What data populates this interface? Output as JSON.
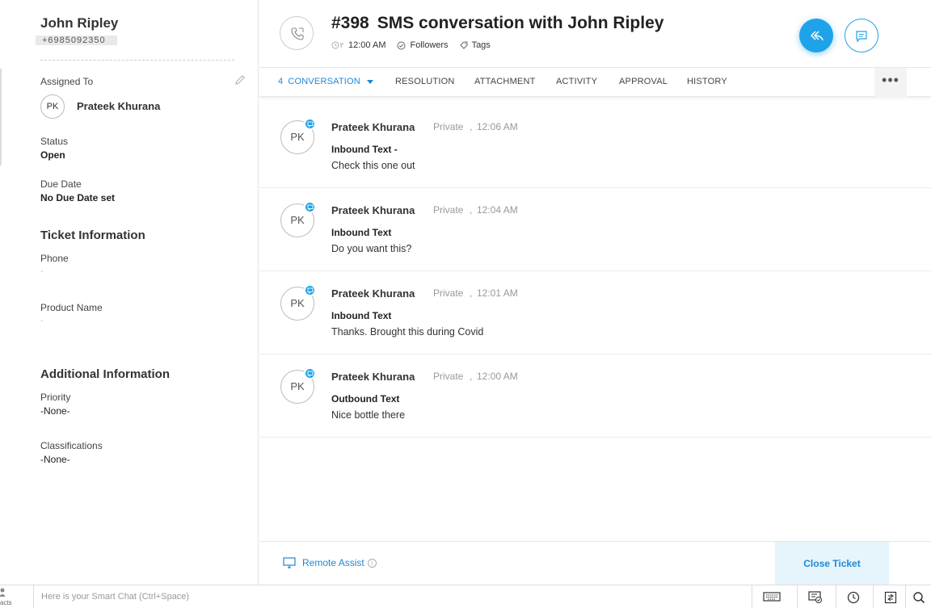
{
  "contact": {
    "name": "John Ripley",
    "phone": "+6985092350"
  },
  "left_panel": {
    "assigned_to_label": "Assigned To",
    "assignee_initials": "PK",
    "assignee_name": "Prateek Khurana",
    "status_label": "Status",
    "status_value": "Open",
    "due_date_label": "Due Date",
    "due_date_value": "No Due Date set",
    "ticket_info_title": "Ticket Information",
    "phone_label": "Phone",
    "phone_value": "-",
    "product_label": "Product Name",
    "product_value": "-",
    "additional_title": "Additional Information",
    "priority_label": "Priority",
    "priority_value": "-None-",
    "classifications_label": "Classifications",
    "classifications_value": "-None-"
  },
  "header": {
    "ticket_number": "#398",
    "title": "SMS conversation with John Ripley",
    "time": "12:00 AM",
    "followers_label": "Followers",
    "tags_label": "Tags"
  },
  "tabs": {
    "conversation_count": "4",
    "conversation": "CONVERSATION",
    "resolution": "RESOLUTION",
    "attachment": "ATTACHMENT",
    "activity": "ACTIVITY",
    "approval": "APPROVAL",
    "history": "HISTORY",
    "more": "•••"
  },
  "messages": [
    {
      "initials": "PK",
      "author": "Prateek Khurana",
      "visibility": "Private",
      "sep": ",",
      "time": "12:06 AM",
      "type": "Inbound Text -",
      "body": "Check this one out"
    },
    {
      "initials": "PK",
      "author": "Prateek Khurana",
      "visibility": "Private",
      "sep": ",",
      "time": "12:04 AM",
      "type": "Inbound Text",
      "body": "Do you want this?"
    },
    {
      "initials": "PK",
      "author": "Prateek Khurana",
      "visibility": "Private",
      "sep": ",",
      "time": "12:01 AM",
      "type": "Inbound Text",
      "body": "Thanks. Brought this during Covid"
    },
    {
      "initials": "PK",
      "author": "Prateek Khurana",
      "visibility": "Private",
      "sep": ",",
      "time": "12:00 AM",
      "type": "Outbound Text",
      "body": "Nice bottle there"
    }
  ],
  "footer": {
    "remote_assist": "Remote Assist",
    "info": "i",
    "close_ticket": "Close Ticket"
  },
  "bottom_bar": {
    "contacts_label": "acts",
    "smart_chat_placeholder": "Here is your Smart Chat (Ctrl+Space)",
    "icons": [
      "keyboard-icon",
      "screen-check-icon",
      "clock-icon",
      "transfer-icon",
      "search-icon"
    ]
  },
  "colors": {
    "accent": "#1fa3e8",
    "link": "#1e88d6"
  }
}
